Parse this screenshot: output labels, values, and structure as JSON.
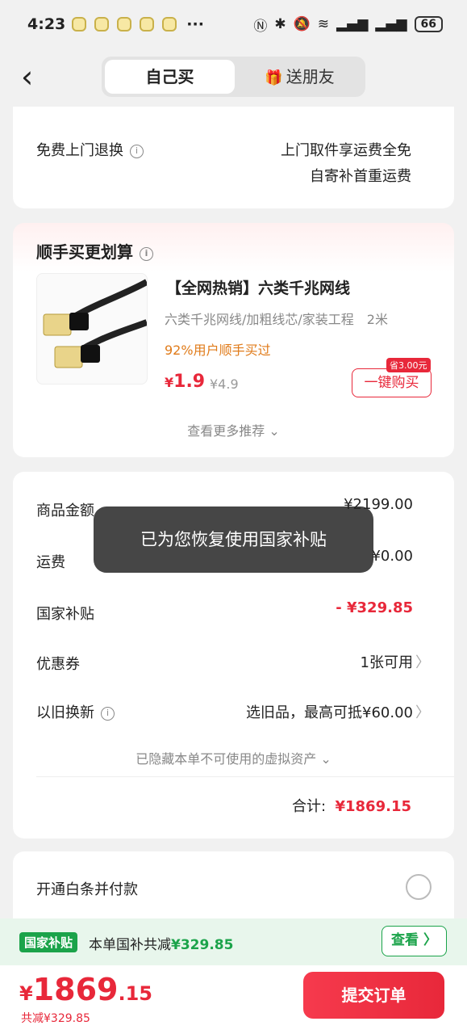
{
  "status_bar": {
    "time": "4:23",
    "more": "···",
    "battery": "66"
  },
  "header": {
    "tab_self": "自己买",
    "tab_gift": "送朋友"
  },
  "return_card": {
    "label": "免费上门退换",
    "line1": "上门取件享运费全免",
    "line2": "自寄补首重运费"
  },
  "recommend": {
    "title": "顺手买更划算",
    "product_name": "【全网热销】六类千兆网线",
    "spec": "六类千兆网线/加粗线芯/家装工程　2米",
    "users": "92%用户顺手买过",
    "price_symbol": "¥",
    "price": "1.9",
    "original_price": "¥4.9",
    "save_tag": "省3.00元",
    "buy_button": "一键购买",
    "more": "查看更多推荐 ⌄"
  },
  "fees": {
    "goods_label": "商品金额",
    "goods_value": "¥2199.00",
    "shipping_label": "运费",
    "shipping_value": "¥0.00",
    "subsidy_label": "国家补贴",
    "subsidy_value": "- ¥329.85",
    "coupon_label": "优惠券",
    "coupon_value": "1张可用",
    "tradein_label": "以旧换新",
    "tradein_value": "选旧品，最高可抵¥60.00",
    "hidden_assets": "已隐藏本单不可使用的虚拟资产 ⌄",
    "total_label": "合计:",
    "total_value": "¥1869.15"
  },
  "baitiao": {
    "label": "开通白条并付款"
  },
  "toast": "已为您恢复使用国家补贴",
  "subsidy_bar": {
    "tag": "国家补贴",
    "text": "本单国补共减",
    "amount": "¥329.85",
    "button": "查看 〉"
  },
  "bottom_bar": {
    "currency": "¥",
    "price_int": "1869",
    "price_dec": ".15",
    "saved": "共减¥329.85",
    "submit": "提交订单"
  },
  "colors": {
    "accent_red": "#e8283a",
    "subsidy_green": "#1ba34a"
  }
}
